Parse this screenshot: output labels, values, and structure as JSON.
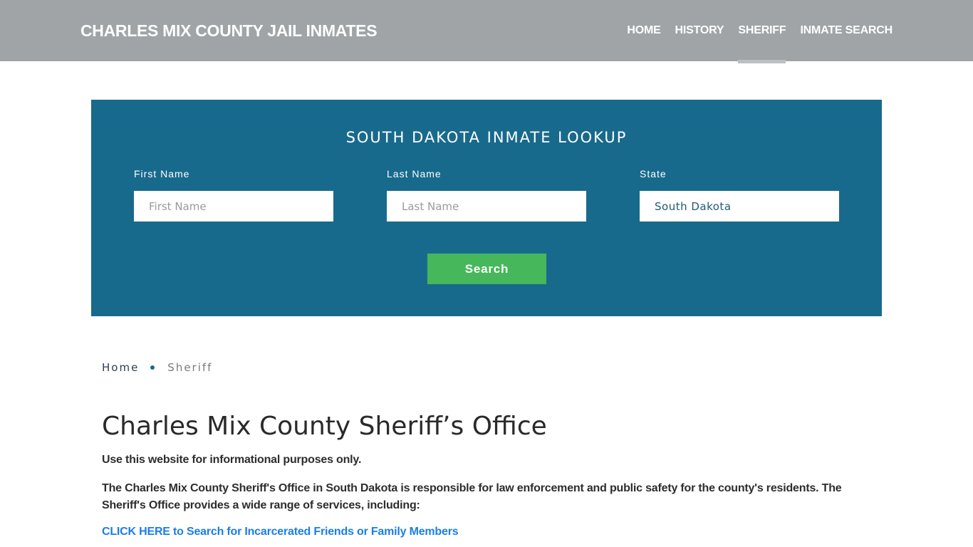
{
  "header": {
    "site_title": "CHARLES MIX COUNTY JAIL INMATES",
    "nav": [
      {
        "label": "HOME",
        "active": false
      },
      {
        "label": "HISTORY",
        "active": false
      },
      {
        "label": "SHERIFF",
        "active": true
      },
      {
        "label": "INMATE SEARCH",
        "active": false
      }
    ]
  },
  "lookup": {
    "title": "SOUTH DAKOTA INMATE LOOKUP",
    "first_name": {
      "label": "First Name",
      "placeholder": "First Name",
      "value": ""
    },
    "last_name": {
      "label": "Last Name",
      "placeholder": "Last Name",
      "value": ""
    },
    "state": {
      "label": "State",
      "value": "South Dakota"
    },
    "search_label": "Search"
  },
  "breadcrumb": {
    "home": "Home",
    "current": "Sheriff"
  },
  "content": {
    "title": "Charles Mix County Sheriff’s Office",
    "disclaimer": "Use this website for informational purposes only.",
    "intro": "The Charles Mix County Sheriff's Office in South Dakota is responsible for law enforcement and public safety for the county's residents. The Sheriff's Office provides a wide range of services, including:",
    "cta_link": "CLICK HERE to Search for Incarcerated Friends or Family Members"
  },
  "colors": {
    "header_bg": "#a0a4a7",
    "panel_bg": "#186a8c",
    "button_bg": "#46b75a",
    "link": "#1a7ee8"
  }
}
